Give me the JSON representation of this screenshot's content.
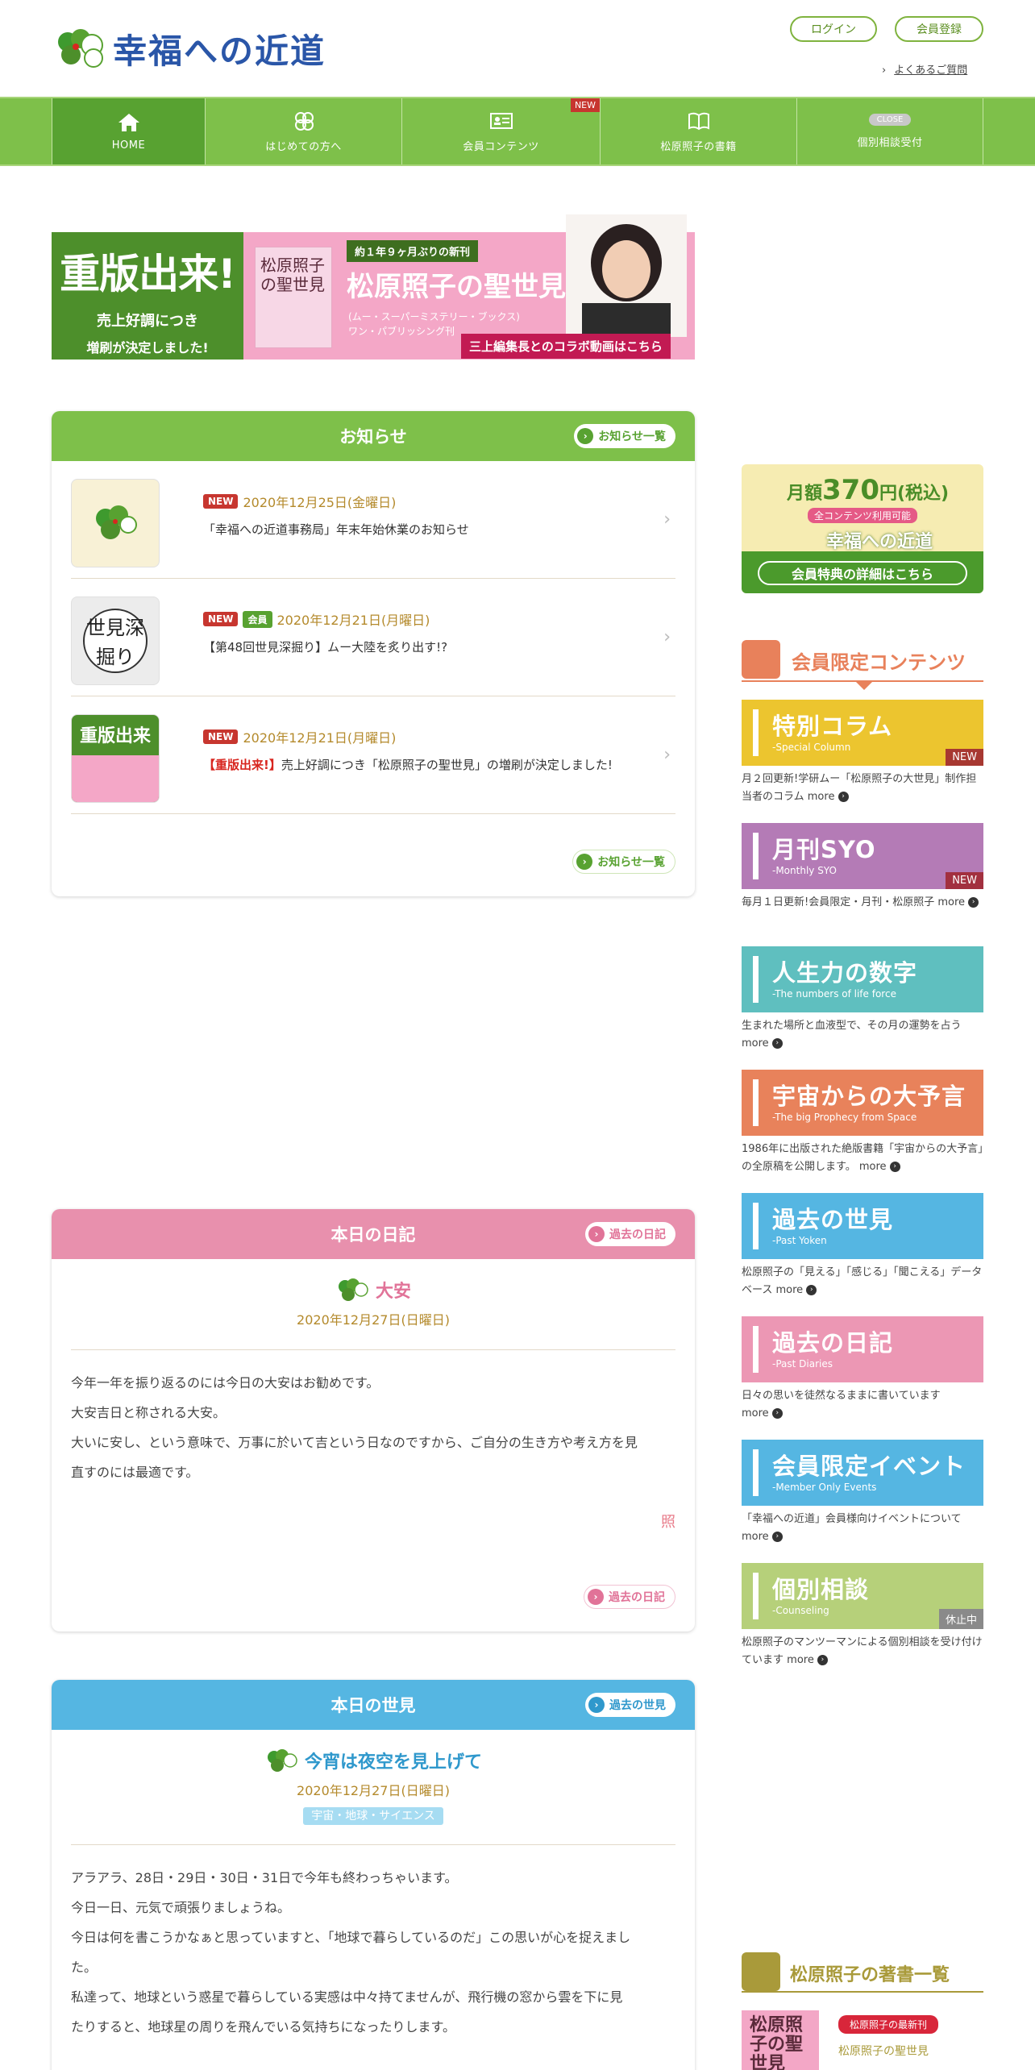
{
  "header": {
    "logo_text": "幸福への近道",
    "login_label": "ログイン",
    "register_label": "会員登録",
    "faq_label": "よくあるご質問"
  },
  "nav": {
    "items": [
      {
        "label": "HOME",
        "icon": "home-icon"
      },
      {
        "label": "はじめての方へ",
        "icon": "flower-icon"
      },
      {
        "label": "会員コンテンツ",
        "icon": "member-card-icon",
        "flag": "NEW"
      },
      {
        "label": "松原照子の書籍",
        "icon": "book-icon"
      },
      {
        "label": "個別相談受付",
        "icon": "consult-icon",
        "pill": "CLOSE"
      }
    ]
  },
  "banner": {
    "headline": "重版出来!",
    "sub1": "売上好調につき",
    "sub2": "増刷が決定しました!",
    "book_text": "松原照子の聖世見",
    "tag": "約１年９ヶ月ぶりの新刊",
    "title": "松原照子の聖世見",
    "sub_series": "(ムー・スーパーミステリー・ブックス)",
    "publisher": "ワン・パブリッシング刊",
    "cta": "三上編集長とのコラボ動画はこちら"
  },
  "news": {
    "title": "お知らせ",
    "list_label": "お知らせ一覧",
    "items": [
      {
        "badges": [
          "NEW"
        ],
        "date": "2020年12月25日(金曜日)",
        "text": "「幸福への近道事務局」年末年始休業のお知らせ",
        "thumb_text": ""
      },
      {
        "badges": [
          "NEW",
          "会員"
        ],
        "date": "2020年12月21日(月曜日)",
        "text": "【第48回世見深掘り】ムー大陸を炙り出す!?",
        "thumb_text": "世見深掘り"
      },
      {
        "badges": [
          "NEW"
        ],
        "date": "2020年12月21日(月曜日)",
        "highlight": "【重版出来!】",
        "text": "売上好調につき「松原照子の聖世見」の増刷が決定しました!",
        "thumb_text": "重版出来"
      }
    ]
  },
  "diary": {
    "header": "本日の日記",
    "list_label": "過去の日記",
    "title": "大安",
    "date": "2020年12月27日(日曜日)",
    "paragraphs": [
      "今年一年を振り返るのには今日の大安はお勧めです。",
      "大安吉日と称される大安。",
      "大いに安し、という意味で、万事に於いて吉という日なのですから、ご自分の生き方や考え方を見",
      "直すのには最適です。"
    ],
    "signature": "照",
    "colors": {
      "accent": "#e890ad"
    }
  },
  "yoken": {
    "header": "本日の世見",
    "list_label": "過去の世見",
    "title": "今宵は夜空を見上げて",
    "date": "2020年12月27日(日曜日)",
    "category": "宇宙・地球・サイエンス",
    "paragraphs": [
      "アラアラ、28日・29日・30日・31日で今年も終わっちゃいます。",
      "今日一日、元気で頑張りましょうね。",
      "今日は何を書こうかなぁと思っていますと、「地球で暮らしているのだ」この思いが心を捉えまし",
      "た。",
      "私達って、地球という惑星で暮らしている実感は中々持てませんが、飛行機の窓から雲を下に見",
      "たりすると、地球星の周りを飛んでいる気持ちになったりします。"
    ],
    "colors": {
      "accent": "#55b6e2"
    }
  },
  "promo": {
    "line1_prefix": "月額",
    "line1_price": "370",
    "line1_suffix": "円(税込)",
    "line2": "全コンテンツ利用可能",
    "line3": "幸福への近道",
    "cta": "会員特典の詳細はこちら"
  },
  "members": {
    "title": "会員限定コンテンツ",
    "more_label": "more",
    "cards": [
      {
        "title": "特別コラム",
        "subtitle": "-Special Column",
        "flag": "NEW",
        "color": "#ecc52f",
        "desc": "月２回更新!学研ムー「松原照子の大世見」制作担当者のコラム"
      },
      {
        "title": "月刊SYO",
        "subtitle": "-Monthly SYO",
        "flag": "NEW",
        "color": "#b47bb6",
        "desc": "毎月１日更新!会員限定・月刊・松原照子"
      },
      {
        "title": "人生力の数字",
        "subtitle": "-The numbers of life force",
        "flag": "",
        "color": "#5fbfbf",
        "desc": "生まれた場所と血液型で、その月の運勢を占う"
      },
      {
        "title": "宇宙からの大予言",
        "subtitle": "-The big Prophecy from Space",
        "flag": "",
        "color": "#e8825b",
        "desc": "1986年に出版された絶版書籍「宇宙からの大予言」の全原稿を公開します。"
      },
      {
        "title": "過去の世見",
        "subtitle": "-Past Yoken",
        "flag": "",
        "color": "#55b6e2",
        "desc": "松原照子の「見える」「感じる」「聞こえる」データベース"
      },
      {
        "title": "過去の日記",
        "subtitle": "-Past Diaries",
        "flag": "",
        "color": "#ec97b4",
        "desc": "日々の思いを徒然なるままに書いています"
      },
      {
        "title": "会員限定イベント",
        "subtitle": "-Member Only Events",
        "flag": "",
        "color": "#55b6e2",
        "desc": "「幸福への近道」会員様向けイベントについて"
      },
      {
        "title": "個別相談",
        "subtitle": "-Counseling",
        "flag": "休止中",
        "color": "#b6d07a",
        "desc": "松原照子のマンツーマンによる個別相談を受け付けています"
      }
    ]
  },
  "books": {
    "title": "松原照子の著書一覧",
    "item_tag": "松原照子の最新刊",
    "item_name": "松原照子の聖世見",
    "cover_text": "松原照子の聖世見"
  }
}
